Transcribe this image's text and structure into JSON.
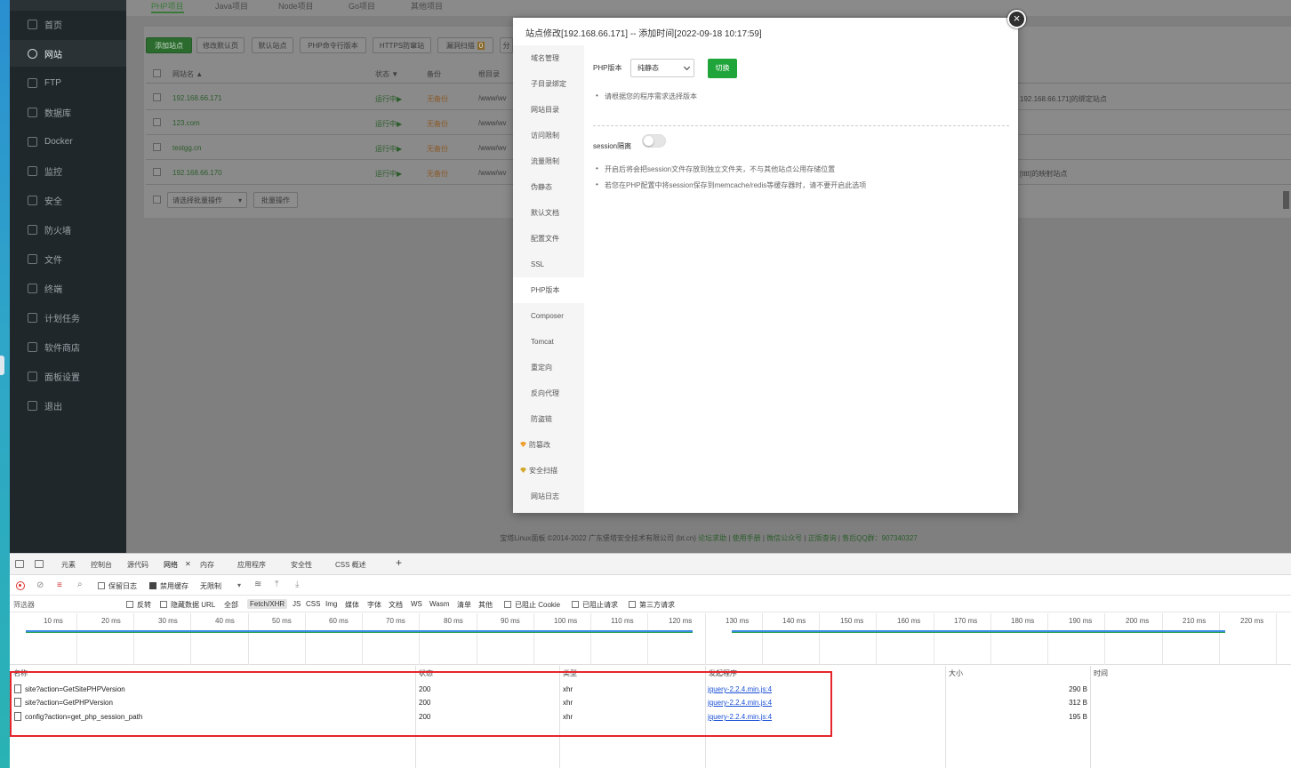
{
  "sidebar": {
    "items": [
      {
        "label": "首页",
        "icon": "home-icon"
      },
      {
        "label": "网站",
        "icon": "globe-icon"
      },
      {
        "label": "FTP",
        "icon": "ftp-icon"
      },
      {
        "label": "数据库",
        "icon": "database-icon"
      },
      {
        "label": "Docker",
        "icon": "docker-icon"
      },
      {
        "label": "监控",
        "icon": "monitor-icon"
      },
      {
        "label": "安全",
        "icon": "shield-icon"
      },
      {
        "label": "防火墙",
        "icon": "firewall-icon"
      },
      {
        "label": "文件",
        "icon": "folder-icon"
      },
      {
        "label": "终端",
        "icon": "terminal-icon"
      },
      {
        "label": "计划任务",
        "icon": "calendar-icon"
      },
      {
        "label": "软件商店",
        "icon": "apps-icon"
      },
      {
        "label": "面板设置",
        "icon": "gear-icon"
      },
      {
        "label": "退出",
        "icon": "logout-icon"
      }
    ],
    "active_index": 1
  },
  "main": {
    "project_tabs": [
      "PHP项目",
      "Java项目",
      "Node项目",
      "Go项目",
      "其他项目"
    ],
    "toolbar": {
      "add_site": "添加站点",
      "modify_default": "修改默认页",
      "default_site": "默认站点",
      "php_cli": "PHP命令行版本",
      "https_firewall": "HTTPS防窜站",
      "vuln_scan": "漏洞扫描",
      "vuln_badge": "0",
      "more": "分"
    },
    "table": {
      "headers": [
        "网站名 ▲",
        "状态 ▼",
        "备份",
        "根目录"
      ],
      "rows": [
        {
          "name": "192.168.66.171",
          "status": "运行中▶",
          "backup": "无备份",
          "path": "/www/wv",
          "note": "192.168.66.171]的绑定站点"
        },
        {
          "name": "123.com",
          "status": "运行中▶",
          "backup": "无备份",
          "path": "/www/wv",
          "note": ""
        },
        {
          "name": "testgg.cn",
          "status": "运行中▶",
          "backup": "无备份",
          "path": "/www/wv",
          "note": ""
        },
        {
          "name": "192.168.66.170",
          "status": "运行中▶",
          "backup": "无备份",
          "path": "/www/wv",
          "note": "[tttt]的映射站点"
        }
      ],
      "batch_select": "请选择批量操作",
      "batch_btn": "批量操作"
    },
    "footer": {
      "copyright": "宝塔Linux面板 ©2014-2022 广东堡塔安全技术有限公司 (bt.cn)",
      "links": [
        "论坛求助",
        "使用手册",
        "微信公众号",
        "正版查询",
        "售后QQ群：907340327"
      ]
    }
  },
  "modal": {
    "title": "站点修改[192.168.66.171] -- 添加时间[2022-09-18 10:17:59]",
    "nav": [
      "域名管理",
      "子目录绑定",
      "网站目录",
      "访问限制",
      "流量限制",
      "伪静态",
      "默认文档",
      "配置文件",
      "SSL",
      "PHP版本",
      "Composer",
      "Tomcat",
      "重定向",
      "反向代理",
      "防盗链",
      "防篡改",
      "安全扫描",
      "网站日志"
    ],
    "nav_active": "PHP版本",
    "php_label": "PHP版本",
    "php_selected": "纯静态",
    "switch_label": "切换",
    "tip1": "请根据您的程序需求选择版本",
    "session_label": "session隔离",
    "session_enabled": false,
    "tip2": "开启后将会把session文件存放到独立文件夹，不与其他站点公用存储位置",
    "tip3": "若您在PHP配置中将session保存到memcache/redis等缓存器时，请不要开启此选项"
  },
  "devtools": {
    "tabs": [
      "元素",
      "控制台",
      "源代码",
      "网络",
      "内存",
      "应用程序",
      "安全性",
      "CSS 概述"
    ],
    "active_tab": "网络",
    "toolbar": {
      "preserve_log": "保留日志",
      "disable_cache": "禁用缓存",
      "throttle": "无限制"
    },
    "filter": {
      "placeholder": "筛选器",
      "invert": "反转",
      "hide_data_url": "隐藏数据 URL",
      "all": "全部",
      "types": [
        "Fetch/XHR",
        "JS",
        "CSS",
        "Img",
        "媒体",
        "字体",
        "文档",
        "WS",
        "Wasm",
        "清单",
        "其他"
      ],
      "blocked_cookies": "已阻止 Cookie",
      "blocked_requests": "已阻止请求",
      "third_party": "第三方请求"
    },
    "timeline_ticks": [
      "10 ms",
      "20 ms",
      "30 ms",
      "40 ms",
      "50 ms",
      "60 ms",
      "70 ms",
      "80 ms",
      "90 ms",
      "100 ms",
      "110 ms",
      "120 ms",
      "130 ms",
      "140 ms",
      "150 ms",
      "160 ms",
      "170 ms",
      "180 ms",
      "190 ms",
      "200 ms",
      "210 ms",
      "220 ms"
    ],
    "columns": [
      "名称",
      "状态",
      "类型",
      "发起程序",
      "大小",
      "时间"
    ],
    "requests": [
      {
        "name": "site?action=GetSitePHPVersion",
        "status": "200",
        "type": "xhr",
        "initiator": "jquery-2.2.4.min.js:4",
        "size": "290 B"
      },
      {
        "name": "site?action=GetPHPVersion",
        "status": "200",
        "type": "xhr",
        "initiator": "jquery-2.2.4.min.js:4",
        "size": "312 B"
      },
      {
        "name": "config?action=get_php_session_path",
        "status": "200",
        "type": "xhr",
        "initiator": "jquery-2.2.4.min.js:4",
        "size": "195 B"
      }
    ]
  }
}
